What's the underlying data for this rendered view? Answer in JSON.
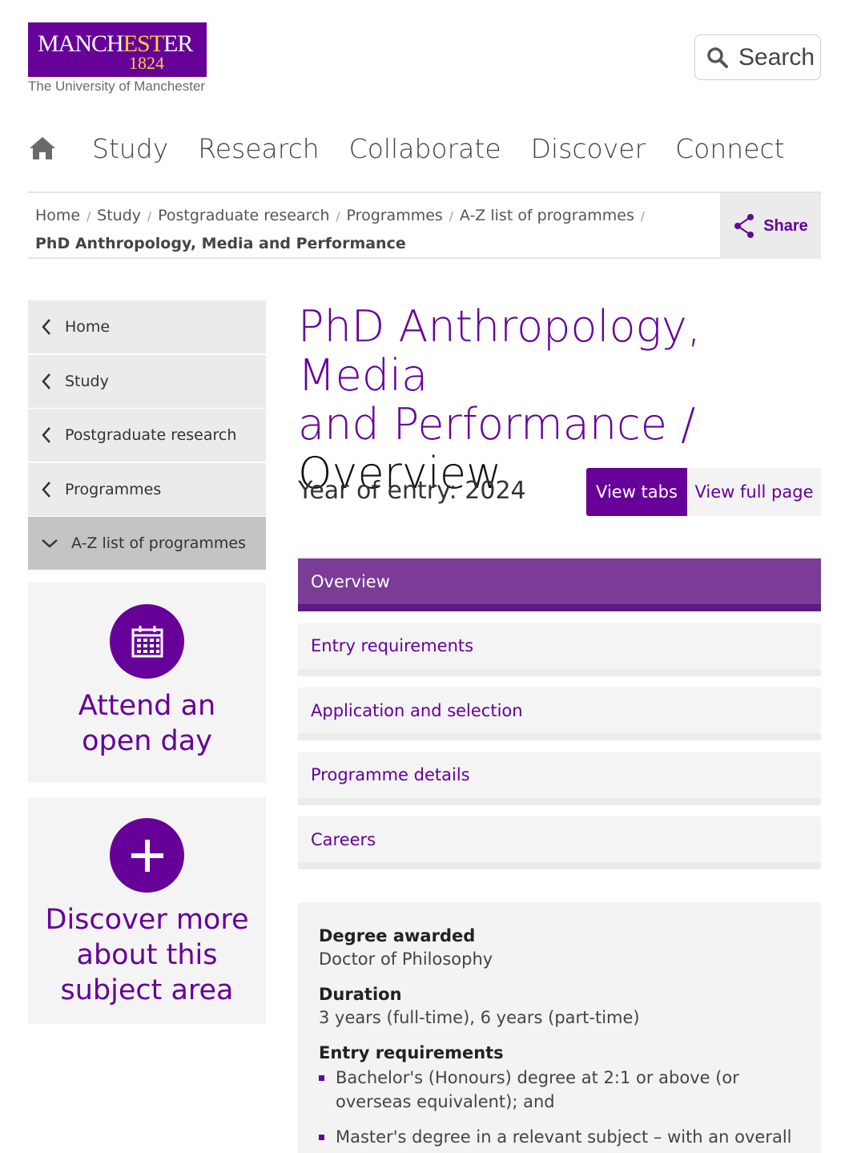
{
  "header": {
    "logo_main_a": "MANCH",
    "logo_main_b": "EST",
    "logo_main_c": "ER",
    "logo_year": "1824",
    "logo_sub": "The University of Manchester",
    "search_label": "Search"
  },
  "nav": {
    "items": [
      "Study",
      "Research",
      "Collaborate",
      "Discover",
      "Connect"
    ]
  },
  "breadcrumb": {
    "items": [
      "Home",
      "Study",
      "Postgraduate research",
      "Programmes",
      "A-Z list of programmes"
    ],
    "current": "PhD Anthropology, Media and Performance",
    "share_label": "Share"
  },
  "sidebar": {
    "items": [
      "Home",
      "Study",
      "Postgraduate research",
      "Programmes",
      "A-Z list of programmes"
    ],
    "promo1": "Attend an open day",
    "promo2": "Discover more about this subject area"
  },
  "main": {
    "title_purple_line1": "PhD Anthropology, Media",
    "title_purple_line2": "and Performance /",
    "title_dark": "Overview",
    "year_of_entry": "Year of entry: 2024",
    "view_tabs": "View tabs",
    "view_full": "View full page",
    "tabs": [
      "Overview",
      "Entry requirements",
      "Application and selection",
      "Programme details",
      "Careers"
    ]
  },
  "info": {
    "degree_label": "Degree awarded",
    "degree_value": "Doctor of Philosophy",
    "duration_label": "Duration",
    "duration_value": "3 years (full-time), 6 years (part-time)",
    "entry_label": "Entry requirements",
    "entry_items": [
      "Bachelor's (Honours) degree at 2:1 or above (or overseas equivalent); and",
      "Master's degree in a relevant subject – with an overall"
    ]
  },
  "colors": {
    "brand": "#660099",
    "gold": "#ffcc33",
    "tab_active": "#7a3c96"
  }
}
